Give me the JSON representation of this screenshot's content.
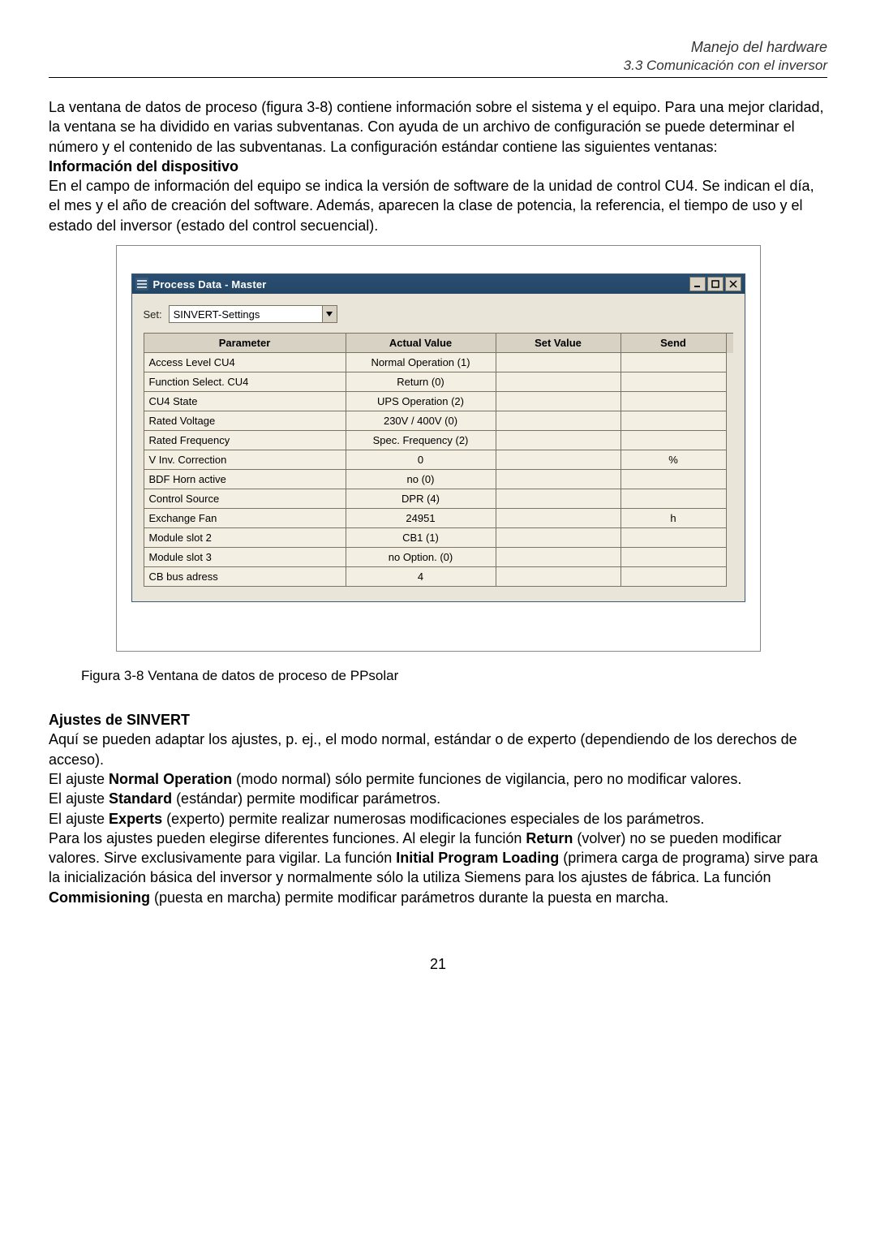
{
  "header": {
    "title": "Manejo del hardware",
    "subtitle": "3.3 Comunicación con el inversor"
  },
  "intro": {
    "p1": "La ventana de datos de proceso (figura 3-8) contiene información sobre el sistema y el equipo. Para una mejor claridad, la ventana se ha dividido en varias subventanas. Con ayuda de un archivo de configuración se puede determinar el número y el contenido de las subventanas. La configuración estándar contiene las siguientes ventanas:",
    "h1": "Información del dispositivo",
    "p2": "En el campo de información del equipo se indica la versión de software de la unidad de control CU4. Se indican el día, el mes y el año de creación del software. Además, aparecen la clase de potencia, la referencia, el tiempo de uso y el estado del inversor (estado del control secuencial)."
  },
  "window": {
    "title": "Process Data - Master",
    "set_label": "Set:",
    "set_value": "SINVERT-Settings",
    "columns": {
      "parameter": "Parameter",
      "actual": "Actual Value",
      "set": "Set Value",
      "send": "Send"
    },
    "rows": [
      {
        "param": "Access Level CU4",
        "actual": "Normal Operation (1)",
        "set": "",
        "send": ""
      },
      {
        "param": "Function Select. CU4",
        "actual": "Return (0)",
        "set": "",
        "send": ""
      },
      {
        "param": "CU4 State",
        "actual": "UPS Operation (2)",
        "set": "",
        "send": ""
      },
      {
        "param": "Rated Voltage",
        "actual": "230V / 400V (0)",
        "set": "",
        "send": ""
      },
      {
        "param": "Rated Frequency",
        "actual": "Spec. Frequency (2)",
        "set": "",
        "send": ""
      },
      {
        "param": "V Inv. Correction",
        "actual": "0",
        "set": "",
        "send": "%"
      },
      {
        "param": "BDF Horn active",
        "actual": "no (0)",
        "set": "",
        "send": ""
      },
      {
        "param": "Control Source",
        "actual": "DPR (4)",
        "set": "",
        "send": ""
      },
      {
        "param": "Exchange Fan",
        "actual": "24951",
        "set": "",
        "send": "h"
      },
      {
        "param": "Module slot 2",
        "actual": "CB1 (1)",
        "set": "",
        "send": ""
      },
      {
        "param": "Module slot 3",
        "actual": "no Option. (0)",
        "set": "",
        "send": ""
      },
      {
        "param": "CB bus adress",
        "actual": "4",
        "set": "",
        "send": ""
      }
    ]
  },
  "figure_caption": "Figura 3-8 Ventana de datos de proceso de PPsolar",
  "section2": {
    "h": "Ajustes de SINVERT",
    "p1": "Aquí se pueden adaptar los ajustes, p. ej., el modo normal, estándar o de experto (dependiendo de los derechos de acceso).",
    "p2a": "El ajuste ",
    "p2b": "Normal Operation",
    "p2c": " (modo normal) sólo permite funciones de vigilancia, pero no modificar valores.",
    "p3a": "El ajuste ",
    "p3b": "Standard",
    "p3c": " (estándar) permite modificar parámetros.",
    "p4a": "El ajuste ",
    "p4b": "Experts",
    "p4c": " (experto) permite realizar numerosas modificaciones especiales de los parámetros.",
    "p5a": "Para los ajustes pueden elegirse diferentes funciones. Al elegir la función ",
    "p5b": "Return",
    "p5c": " (volver) no se pueden modificar valores. Sirve exclusivamente para vigilar. La función ",
    "p5d": "Initial Program Loading",
    "p5e": " (primera carga de programa) sirve para la inicialización básica del inversor y normalmente sólo la utiliza Siemens para los ajustes de fábrica. La función ",
    "p5f": "Commisioning",
    "p5g": " (puesta en marcha) permite modificar parámetros durante la puesta en marcha."
  },
  "page_number": "21"
}
